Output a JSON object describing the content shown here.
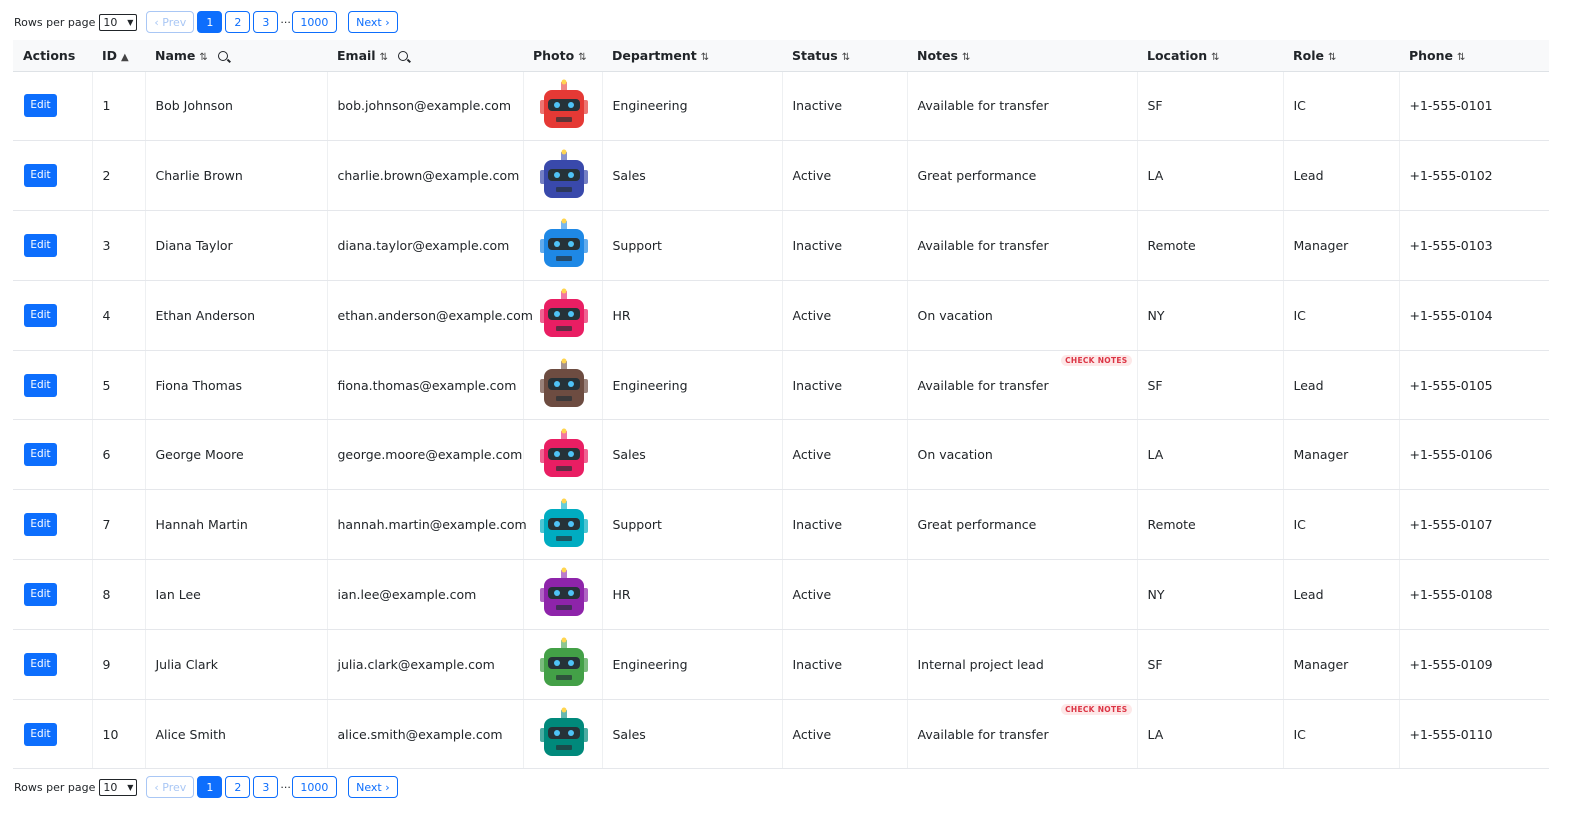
{
  "pagination": {
    "rows_per_page_label": "Rows per page",
    "rows_per_page_value": "10",
    "prev_label": "‹ Prev",
    "next_label": "Next ›",
    "pages": [
      "1",
      "2",
      "3"
    ],
    "ellipsis": "···",
    "last_page": "1000",
    "current_page": "1"
  },
  "columns": {
    "actions": "Actions",
    "id": "ID",
    "id_sort": "▲",
    "name": "Name",
    "email": "Email",
    "photo": "Photo",
    "department": "Department",
    "status": "Status",
    "notes": "Notes",
    "location": "Location",
    "role": "Role",
    "phone": "Phone",
    "sort_icon": "⇅"
  },
  "edit_label": "Edit",
  "badge_label": "CHECK NOTES",
  "rows": [
    {
      "id": "1",
      "name": "Bob Johnson",
      "email": "bob.johnson@example.com",
      "avatar_color": "#e53935",
      "department": "Engineering",
      "status": "Inactive",
      "notes": "Available for transfer",
      "location": "SF",
      "role": "IC",
      "phone": "+1-555-0101",
      "badge": false
    },
    {
      "id": "2",
      "name": "Charlie Brown",
      "email": "charlie.brown@example.com",
      "avatar_color": "#3949ab",
      "department": "Sales",
      "status": "Active",
      "notes": "Great performance",
      "location": "LA",
      "role": "Lead",
      "phone": "+1-555-0102",
      "badge": false
    },
    {
      "id": "3",
      "name": "Diana Taylor",
      "email": "diana.taylor@example.com",
      "avatar_color": "#1e88e5",
      "department": "Support",
      "status": "Inactive",
      "notes": "Available for transfer",
      "location": "Remote",
      "role": "Manager",
      "phone": "+1-555-0103",
      "badge": false
    },
    {
      "id": "4",
      "name": "Ethan Anderson",
      "email": "ethan.anderson@example.com",
      "avatar_color": "#e91e63",
      "department": "HR",
      "status": "Active",
      "notes": "On vacation",
      "location": "NY",
      "role": "IC",
      "phone": "+1-555-0104",
      "badge": false
    },
    {
      "id": "5",
      "name": "Fiona Thomas",
      "email": "fiona.thomas@example.com",
      "avatar_color": "#6d4c41",
      "department": "Engineering",
      "status": "Inactive",
      "notes": "Available for transfer",
      "location": "SF",
      "role": "Lead",
      "phone": "+1-555-0105",
      "badge": true
    },
    {
      "id": "6",
      "name": "George Moore",
      "email": "george.moore@example.com",
      "avatar_color": "#e91e63",
      "department": "Sales",
      "status": "Active",
      "notes": "On vacation",
      "location": "LA",
      "role": "Manager",
      "phone": "+1-555-0106",
      "badge": false
    },
    {
      "id": "7",
      "name": "Hannah Martin",
      "email": "hannah.martin@example.com",
      "avatar_color": "#00acc1",
      "department": "Support",
      "status": "Inactive",
      "notes": "Great performance",
      "location": "Remote",
      "role": "IC",
      "phone": "+1-555-0107",
      "badge": false
    },
    {
      "id": "8",
      "name": "Ian Lee",
      "email": "ian.lee@example.com",
      "avatar_color": "#8e24aa",
      "department": "HR",
      "status": "Active",
      "notes": "",
      "location": "NY",
      "role": "Lead",
      "phone": "+1-555-0108",
      "badge": false
    },
    {
      "id": "9",
      "name": "Julia Clark",
      "email": "julia.clark@example.com",
      "avatar_color": "#43a047",
      "department": "Engineering",
      "status": "Inactive",
      "notes": "Internal project lead",
      "location": "SF",
      "role": "Manager",
      "phone": "+1-555-0109",
      "badge": false
    },
    {
      "id": "10",
      "name": "Alice Smith",
      "email": "alice.smith@example.com",
      "avatar_color": "#00897b",
      "department": "Sales",
      "status": "Active",
      "notes": "Available for transfer",
      "location": "LA",
      "role": "IC",
      "phone": "+1-555-0110",
      "badge": true
    }
  ]
}
